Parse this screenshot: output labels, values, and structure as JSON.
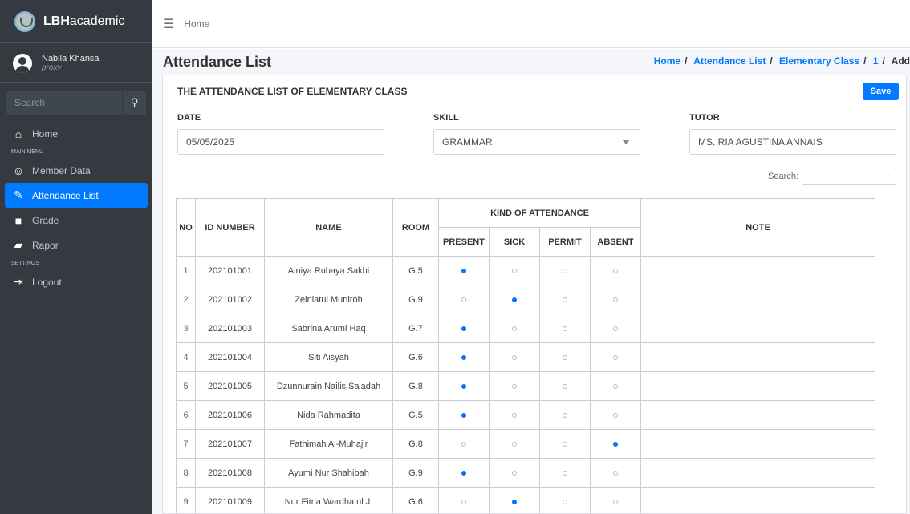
{
  "brand": {
    "bold": "LBH",
    "rest": "academic"
  },
  "user": {
    "name": "Nabila Khansa",
    "role": "proxy"
  },
  "sidebar": {
    "search_placeholder": "Search",
    "items": [
      {
        "label": "Home",
        "icon": "home-icon"
      },
      {
        "header": "MAIN MENU"
      },
      {
        "label": "Member Data",
        "icon": "users-icon"
      },
      {
        "label": "Attendance List",
        "icon": "edit-icon",
        "active": true
      },
      {
        "label": "Grade",
        "icon": "file-icon"
      },
      {
        "label": "Rapor",
        "icon": "folder-open-icon"
      },
      {
        "header": "SETTINGS"
      },
      {
        "label": "Logout",
        "icon": "sign-out-icon"
      }
    ]
  },
  "topbar": {
    "home": "Home"
  },
  "page": {
    "title": "Attendance List",
    "breadcrumb": [
      "Home",
      "Attendance List",
      "Elementary Class",
      "1"
    ],
    "breadcrumb_current": "Add"
  },
  "card": {
    "title": "THE ATTENDANCE LIST OF ELEMENTARY CLASS",
    "save_label": "Save"
  },
  "form": {
    "date_label": "DATE",
    "date_value": "05/05/2025",
    "skill_label": "SKILL",
    "skill_value": "GRAMMAR",
    "tutor_label": "TUTOR",
    "tutor_value": "MS. RIA AGUSTINA ANNAIS",
    "search_label": "Search:"
  },
  "table": {
    "headers": {
      "no": "NO",
      "id": "ID NUMBER",
      "name": "NAME",
      "room": "ROOM",
      "kind": "KIND OF ATTENDANCE",
      "present": "PRESENT",
      "sick": "SICK",
      "permit": "PERMIT",
      "absent": "ABSENT",
      "note": "NOTE"
    },
    "rows": [
      {
        "no": "1",
        "id": "202101001",
        "name": "Ainiya Rubaya Sakhi",
        "room": "G.5",
        "status": "present"
      },
      {
        "no": "2",
        "id": "202101002",
        "name": "Zeiniatul Muniroh",
        "room": "G.9",
        "status": "sick"
      },
      {
        "no": "3",
        "id": "202101003",
        "name": "Sabrina Arumi Haq",
        "room": "G.7",
        "status": "present"
      },
      {
        "no": "4",
        "id": "202101004",
        "name": "Siti Aisyah",
        "room": "G.6",
        "status": "present"
      },
      {
        "no": "5",
        "id": "202101005",
        "name": "Dzunnurain Nailis Sa'adah",
        "room": "G.8",
        "status": "present"
      },
      {
        "no": "6",
        "id": "202101006",
        "name": "Nida Rahmadita",
        "room": "G.5",
        "status": "present"
      },
      {
        "no": "7",
        "id": "202101007",
        "name": "Fathimah Al-Muhajir",
        "room": "G.8",
        "status": "absent"
      },
      {
        "no": "8",
        "id": "202101008",
        "name": "Ayumi Nur Shahibah",
        "room": "G.9",
        "status": "present"
      },
      {
        "no": "9",
        "id": "202101009",
        "name": "Nur Fitria Wardhatul J.",
        "room": "G.6",
        "status": "sick"
      }
    ]
  }
}
